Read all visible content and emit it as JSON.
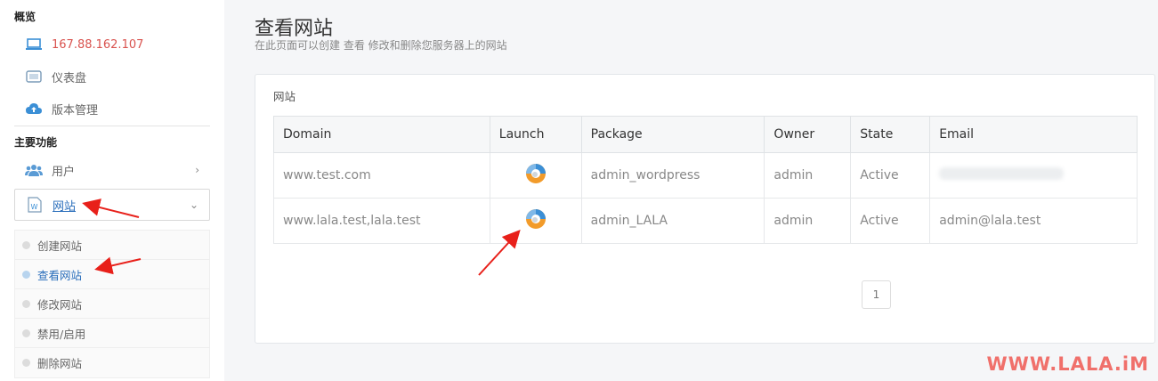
{
  "sidebar": {
    "overview_title": "概览",
    "ip_label": "167.88.162.107",
    "dashboard_label": "仪表盘",
    "version_label": "版本管理",
    "main_title": "主要功能",
    "users_label": "用户",
    "sites_label": "网站",
    "sub_items": [
      "创建网站",
      "查看网站",
      "修改网站",
      "禁用/启用",
      "删除网站"
    ]
  },
  "page": {
    "title": "查看网站",
    "subtitle": "在此页面可以创建 查看 修改和删除您服务器上的网站",
    "panel_title": "网站"
  },
  "table": {
    "headers": [
      "Domain",
      "Launch",
      "Package",
      "Owner",
      "State",
      "Email"
    ],
    "rows": [
      {
        "domain": "www.test.com",
        "package": "admin_wordpress",
        "owner": "admin",
        "state": "Active",
        "email": ""
      },
      {
        "domain": "www.lala.test,lala.test",
        "package": "admin_LALA",
        "owner": "admin",
        "state": "Active",
        "email": "admin@lala.test"
      }
    ]
  },
  "pagination": {
    "current": "1"
  },
  "watermark": "WWW.LALA.iM",
  "colors": {
    "accent": "#2a6ebb",
    "ip": "#d9534f",
    "arrow": "#e8201a",
    "watermark": "#f0706b"
  }
}
